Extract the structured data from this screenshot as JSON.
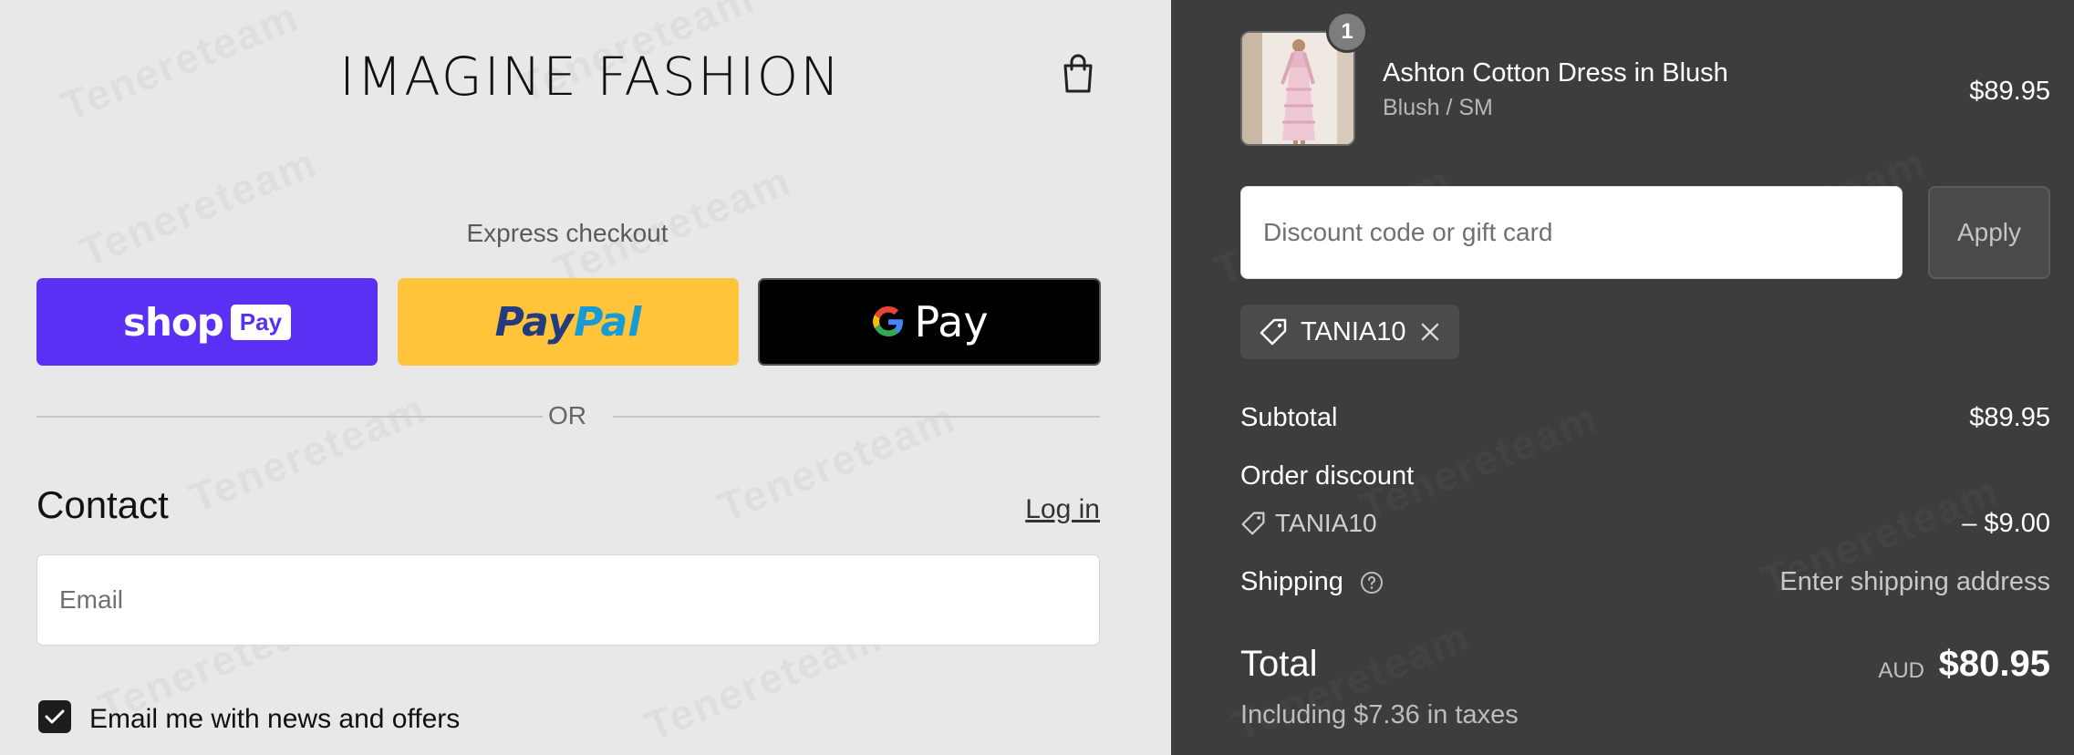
{
  "store": {
    "brand": "IMAGINE FASHION",
    "cart_icon": "shopping-bag-icon"
  },
  "express": {
    "label": "Express checkout",
    "shop_pay": {
      "word": "shop",
      "badge": "Pay",
      "color": "#5a31f4"
    },
    "paypal": {
      "pay": "Pay",
      "pal": "Pal",
      "color": "#ffc439"
    },
    "google_pay": {
      "word": "Pay",
      "color": "#000000"
    }
  },
  "divider": {
    "or": "OR"
  },
  "contact": {
    "title": "Contact",
    "login": "Log in",
    "email_placeholder": "Email",
    "newsletter_label": "Email me with news and offers",
    "newsletter_checked": true
  },
  "summary": {
    "product": {
      "name": "Ashton Cotton Dress in Blush",
      "variant": "Blush / SM",
      "price": "$89.95",
      "quantity": "1"
    },
    "discount": {
      "placeholder": "Discount code or gift card",
      "apply": "Apply",
      "applied_code": "TANIA10"
    },
    "subtotal": {
      "label": "Subtotal",
      "value": "$89.95"
    },
    "order_discount": {
      "label": "Order discount",
      "code": "TANIA10",
      "value": "– $9.00"
    },
    "shipping": {
      "label": "Shipping",
      "value": "Enter shipping address"
    },
    "total": {
      "label": "Total",
      "currency": "AUD",
      "value": "$80.95",
      "tax_note": "Including $7.36 in taxes"
    }
  },
  "colors": {
    "left_bg": "#e8e8e8",
    "right_bg": "#3d3d3d",
    "accent_dark": "#1d1d1d"
  }
}
